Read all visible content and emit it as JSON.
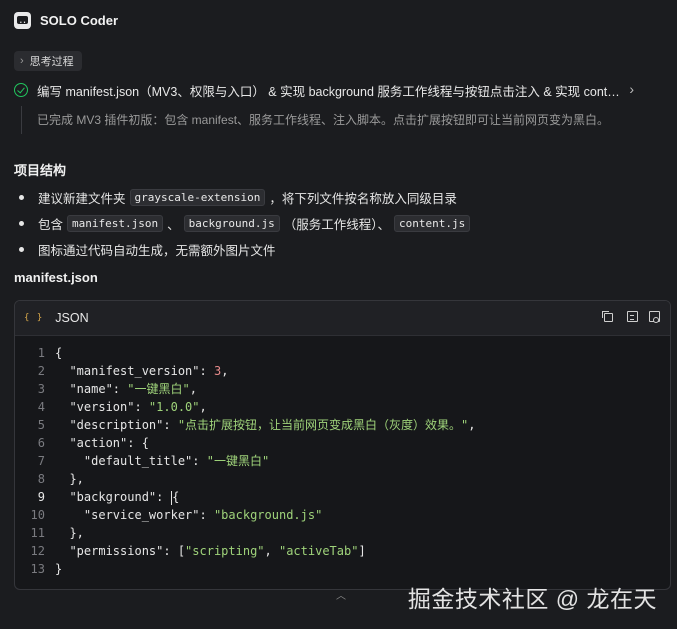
{
  "header": {
    "app_title": "SOLO Coder",
    "icon": "solo-app-icon"
  },
  "thinking": {
    "label": "思考过程",
    "icon": "chevron-right-icon"
  },
  "task": {
    "status_icon": "check-circle-icon",
    "status_color": "#22c55e",
    "title": "编写 manifest.json（MV3、权限与入口） & 实现 background 服务工作线程与按钮点击注入 & 实现 content.js",
    "note": "已完成 MV3 插件初版：包含 manifest、服务工作线程、注入脚本。点击扩展按钮即可让当前网页变为黑白。"
  },
  "structure": {
    "title": "项目结构",
    "bullet1": {
      "pre": "建议新建文件夹",
      "code": "grayscale-extension",
      "post": "，将下列文件按名称放入同级目录"
    },
    "bullet2": {
      "pre": "包含",
      "code1": "manifest.json",
      "sep1": "、",
      "code2": "background.js",
      "mid": "（服务工作线程）、",
      "code3": "content.js"
    },
    "bullet3": {
      "text": "图标通过代码自动生成，无需额外图片文件"
    }
  },
  "manifest_section": {
    "title": "manifest.json"
  },
  "code_block": {
    "language": "JSON",
    "toolbar_icons": [
      "copy-icon",
      "insert-icon",
      "apply-icon"
    ],
    "active_line": 9,
    "lines": [
      {
        "n": "1",
        "parts": [
          {
            "t": "{",
            "c": "k"
          }
        ]
      },
      {
        "n": "2",
        "parts": [
          {
            "t": "  \"manifest_version\": ",
            "c": "k"
          },
          {
            "t": "3",
            "c": "n"
          },
          {
            "t": ",",
            "c": "k"
          }
        ]
      },
      {
        "n": "3",
        "parts": [
          {
            "t": "  \"name\": ",
            "c": "k"
          },
          {
            "t": "\"一键黑白\"",
            "c": "s"
          },
          {
            "t": ",",
            "c": "k"
          }
        ]
      },
      {
        "n": "4",
        "parts": [
          {
            "t": "  \"version\": ",
            "c": "k"
          },
          {
            "t": "\"1.0.0\"",
            "c": "s"
          },
          {
            "t": ",",
            "c": "k"
          }
        ]
      },
      {
        "n": "5",
        "parts": [
          {
            "t": "  \"description\": ",
            "c": "k"
          },
          {
            "t": "\"点击扩展按钮，让当前网页变成黑白（灰度）效果。\"",
            "c": "s"
          },
          {
            "t": ",",
            "c": "k"
          }
        ]
      },
      {
        "n": "6",
        "parts": [
          {
            "t": "  \"action\": {",
            "c": "k"
          }
        ]
      },
      {
        "n": "7",
        "parts": [
          {
            "t": "    \"default_title\": ",
            "c": "k"
          },
          {
            "t": "\"一键黑白\"",
            "c": "s"
          }
        ]
      },
      {
        "n": "8",
        "parts": [
          {
            "t": "  },",
            "c": "k"
          }
        ]
      },
      {
        "n": "9",
        "parts": [
          {
            "t": "  \"background\": ",
            "c": "k"
          },
          {
            "t": "|",
            "c": "cursor"
          },
          {
            "t": "{",
            "c": "k"
          }
        ]
      },
      {
        "n": "10",
        "parts": [
          {
            "t": "    \"service_worker\": ",
            "c": "k"
          },
          {
            "t": "\"background.js\"",
            "c": "s"
          }
        ]
      },
      {
        "n": "11",
        "parts": [
          {
            "t": "  },",
            "c": "k"
          }
        ]
      },
      {
        "n": "12",
        "parts": [
          {
            "t": "  \"permissions\": [",
            "c": "k"
          },
          {
            "t": "\"scripting\"",
            "c": "s"
          },
          {
            "t": ", ",
            "c": "k"
          },
          {
            "t": "\"activeTab\"",
            "c": "s"
          },
          {
            "t": "]",
            "c": "k"
          }
        ]
      },
      {
        "n": "13",
        "parts": [
          {
            "t": "}",
            "c": "k"
          }
        ]
      }
    ]
  },
  "scroll": {
    "icon": "chevron-up-icon"
  },
  "watermark": {
    "text": "掘金技术社区 @ 龙在天"
  }
}
